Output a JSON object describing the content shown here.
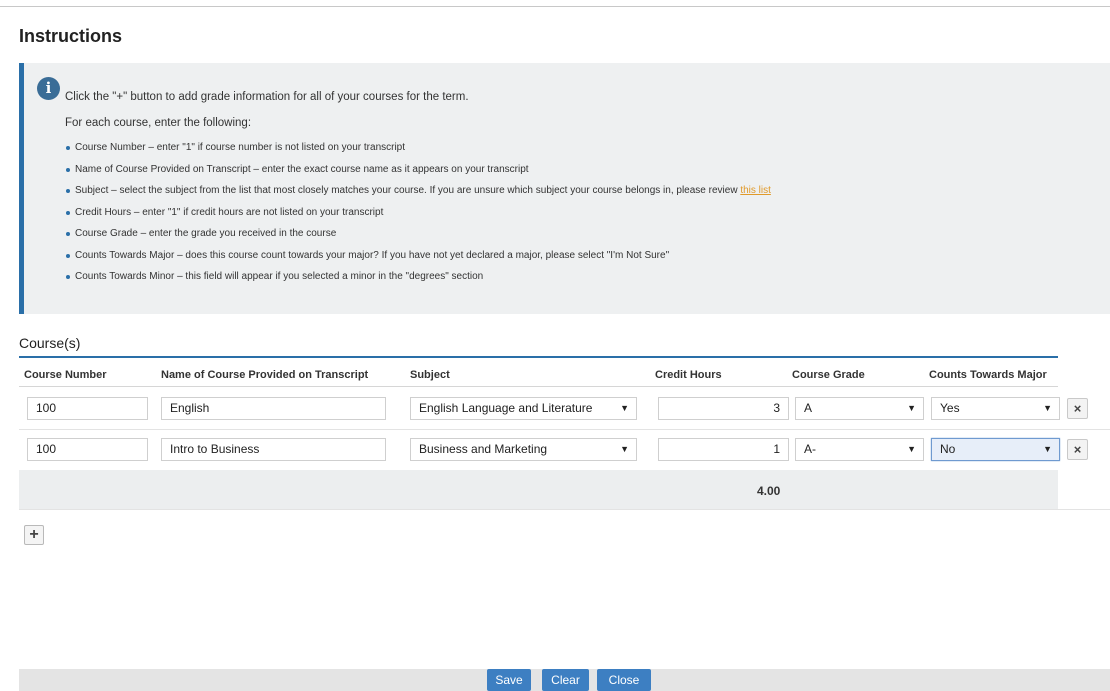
{
  "page": {
    "title": "Instructions"
  },
  "instructions": {
    "intro": "Click the \"+\" button to add grade information for all of your courses for the term.",
    "for_each": "For each course, enter the following:",
    "bullets": [
      "Course Number – enter \"1\" if course number is not listed on your transcript",
      "Name of Course Provided on Transcript – enter the exact course name as it appears on your transcript",
      "Subject – select the subject from the list that most closely matches your course. If you are unsure which subject your course belongs in, please review ",
      "Credit Hours – enter \"1\" if credit hours are not listed on your transcript",
      "Course Grade – enter the grade you received in the course",
      "Counts Towards Major – does this course count towards your major? If you have not yet declared a major, please select \"I'm Not Sure\"",
      "Counts Towards Minor – this field will appear if you selected a minor in the \"degrees\" section"
    ],
    "link_text": "this list"
  },
  "courses": {
    "title": "Course(s)",
    "columns": {
      "course_number": "Course Number",
      "course_name": "Name of Course Provided on Transcript",
      "subject": "Subject",
      "credit_hours": "Credit Hours",
      "course_grade": "Course Grade",
      "counts_major": "Counts Towards Major"
    },
    "rows": [
      {
        "course_number": "100",
        "course_name": "English",
        "subject": "English Language and Literature",
        "credit_hours": "3",
        "grade": "A",
        "counts_major": "Yes",
        "delete": "×"
      },
      {
        "course_number": "100",
        "course_name": "Intro to Business",
        "subject": "Business and Marketing",
        "credit_hours": "1",
        "grade": "A-",
        "counts_major": "No",
        "delete": "×"
      }
    ],
    "total_credit_hours": "4.00",
    "add_label": "+"
  },
  "icons": {
    "info": "info-icon",
    "dropdown": "chevron-down-icon",
    "delete": "close-icon",
    "add": "plus-icon"
  },
  "footer": {
    "save": "Save",
    "clear": "Clear",
    "close": "Close"
  },
  "colors": {
    "accent": "#2a6fa8",
    "button": "#3d7fc2",
    "link": "#e09a2a"
  }
}
